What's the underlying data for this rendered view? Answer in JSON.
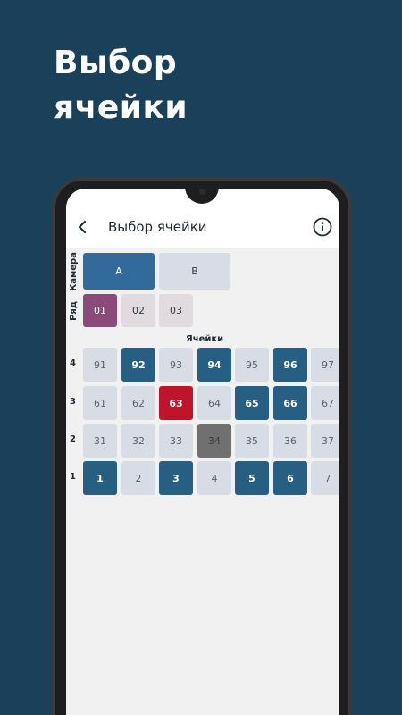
{
  "promo": {
    "line1": "Выбор",
    "line2": "ячейки"
  },
  "appbar": {
    "title": "Выбор ячейки",
    "back_icon": "chevron-left-icon",
    "info_icon": "info-circle-icon"
  },
  "camera": {
    "label": "Камера",
    "options": [
      {
        "label": "A",
        "state": "selected"
      },
      {
        "label": "B",
        "state": "normal"
      }
    ]
  },
  "row_selector": {
    "label": "Ряд",
    "options": [
      {
        "label": "01",
        "state": "selected"
      },
      {
        "label": "02",
        "state": "normal"
      },
      {
        "label": "03",
        "state": "normal"
      }
    ]
  },
  "cells": {
    "label": "Ячейки",
    "rows": [
      {
        "label": "4",
        "cells": [
          {
            "n": "91",
            "s": "free"
          },
          {
            "n": "92",
            "s": "busy"
          },
          {
            "n": "93",
            "s": "free"
          },
          {
            "n": "94",
            "s": "busy"
          },
          {
            "n": "95",
            "s": "free"
          },
          {
            "n": "96",
            "s": "busy"
          },
          {
            "n": "97",
            "s": "free"
          }
        ]
      },
      {
        "label": "3",
        "cells": [
          {
            "n": "61",
            "s": "free"
          },
          {
            "n": "62",
            "s": "free"
          },
          {
            "n": "63",
            "s": "selected"
          },
          {
            "n": "64",
            "s": "free"
          },
          {
            "n": "65",
            "s": "busy"
          },
          {
            "n": "66",
            "s": "busy"
          },
          {
            "n": "67",
            "s": "free"
          }
        ]
      },
      {
        "label": "2",
        "cells": [
          {
            "n": "31",
            "s": "free"
          },
          {
            "n": "32",
            "s": "free"
          },
          {
            "n": "33",
            "s": "free"
          },
          {
            "n": "34",
            "s": "blocked"
          },
          {
            "n": "35",
            "s": "free"
          },
          {
            "n": "36",
            "s": "free"
          },
          {
            "n": "37",
            "s": "free"
          }
        ]
      },
      {
        "label": "1",
        "cells": [
          {
            "n": "1",
            "s": "busy"
          },
          {
            "n": "2",
            "s": "free"
          },
          {
            "n": "3",
            "s": "busy"
          },
          {
            "n": "4",
            "s": "free"
          },
          {
            "n": "5",
            "s": "busy"
          },
          {
            "n": "6",
            "s": "busy"
          },
          {
            "n": "7",
            "s": "free"
          }
        ]
      }
    ]
  },
  "colors": {
    "background": "#1b4059",
    "camera_selected": "#336a9c",
    "camera_normal": "#d8dce4",
    "row_selected": "#8a4a7a",
    "row_normal": "#e1dbe0",
    "cell_free": "#d8dce4",
    "cell_busy": "#265f82",
    "cell_selected": "#c0142a",
    "cell_blocked": "#707070"
  }
}
